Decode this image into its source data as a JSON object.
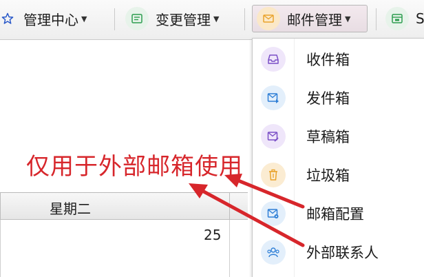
{
  "toolbar": {
    "items": [
      {
        "label": "管理中心",
        "icon": "star-icon"
      },
      {
        "label": "变更管理",
        "icon": "form-icon"
      },
      {
        "label": "邮件管理",
        "icon": "envelope-icon"
      },
      {
        "label": "S",
        "icon": "calendar-icon"
      }
    ]
  },
  "calendar": {
    "day_header": "星期二",
    "date_number": "25"
  },
  "mail_menu": {
    "items": [
      {
        "label": "收件箱",
        "icon": "inbox-icon"
      },
      {
        "label": "发件箱",
        "icon": "outbox-icon"
      },
      {
        "label": "草稿箱",
        "icon": "draft-icon"
      },
      {
        "label": "垃圾箱",
        "icon": "trash-icon"
      },
      {
        "label": "邮箱配置",
        "icon": "mail-settings-icon"
      },
      {
        "label": "外部联系人",
        "icon": "contacts-icon"
      }
    ]
  },
  "annotation": {
    "text": "仅用于外部邮箱使用",
    "color": "#d7262b"
  },
  "colors": {
    "active_tab_bg": "#f3e9ee",
    "icon_purple": "#7a4fc6",
    "icon_blue": "#2f7fd6",
    "icon_green": "#2c9d4e",
    "icon_orange": "#e9a22a"
  }
}
